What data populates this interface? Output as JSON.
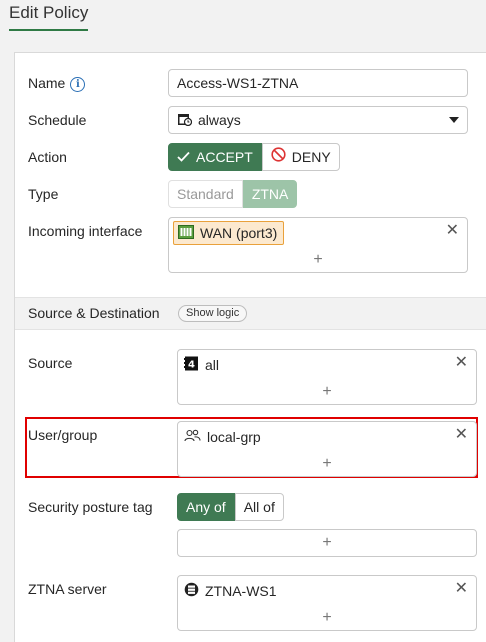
{
  "page": {
    "title": "Edit Policy"
  },
  "form": {
    "name": {
      "label": "Name",
      "value": "Access-WS1-ZTNA",
      "info_icon": "info-icon"
    },
    "schedule": {
      "label": "Schedule",
      "value": "always",
      "icon": "calendar-icon"
    },
    "action": {
      "label": "Action",
      "options": [
        "ACCEPT",
        "DENY"
      ],
      "selected": "ACCEPT"
    },
    "type": {
      "label": "Type",
      "options": [
        "Standard",
        "ZTNA"
      ],
      "selected": "ZTNA"
    },
    "incoming_interface": {
      "label": "Incoming interface",
      "items": [
        "WAN (port3)"
      ],
      "item_icon": "network-port-icon"
    }
  },
  "section": {
    "title": "Source & Destination",
    "logic_button": "Show logic"
  },
  "source": {
    "label": "Source",
    "items": [
      "all"
    ],
    "item_icon": "address-icon"
  },
  "user_group": {
    "label": "User/group",
    "items": [
      "local-grp"
    ],
    "item_icon": "user-group-icon"
  },
  "posture": {
    "label": "Security posture tag",
    "options": [
      "Any of",
      "All of"
    ],
    "selected": "Any of"
  },
  "ztna_server": {
    "label": "ZTNA server",
    "items": [
      "ZTNA-WS1"
    ],
    "item_icon": "server-icon"
  },
  "controls": {
    "remove": "✕",
    "add": "+"
  },
  "colors": {
    "accent_green": "#3f7a53",
    "highlight_red": "#e00000",
    "chip_orange": "#e9a13b"
  }
}
